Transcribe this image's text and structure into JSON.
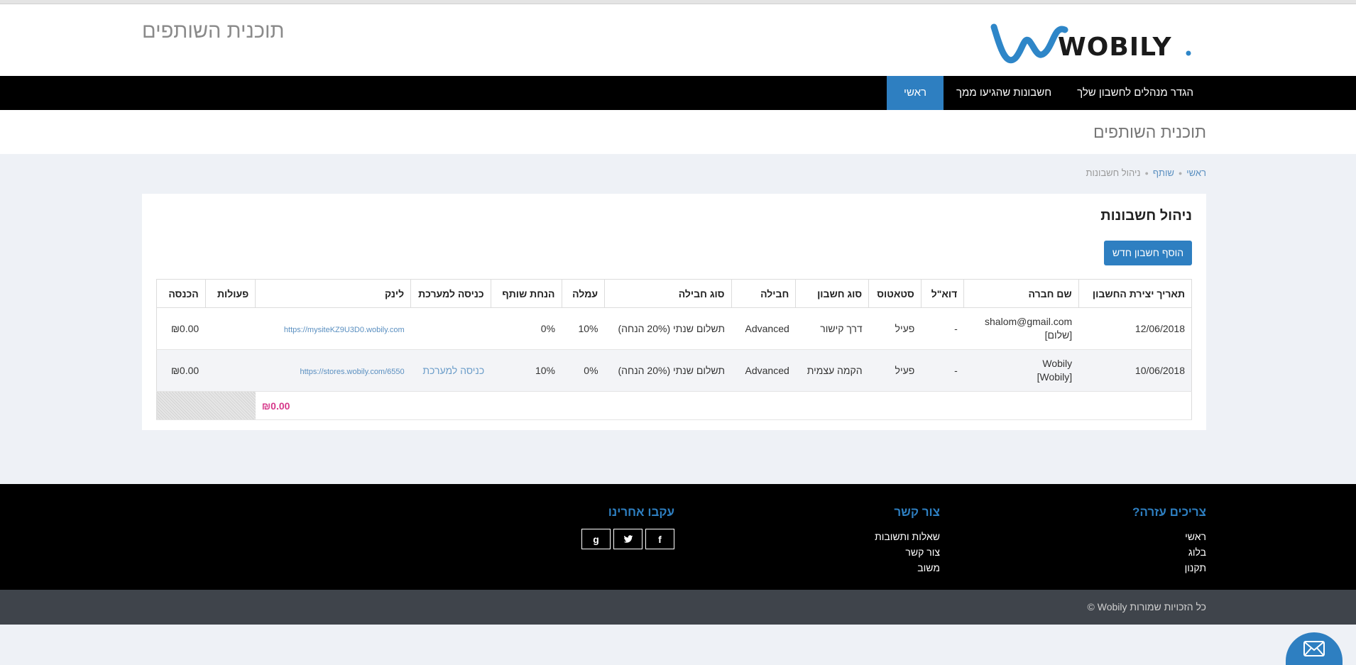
{
  "header": {
    "title": "תוכנית השותפים",
    "logo_text": "WOBILY"
  },
  "nav": {
    "items": [
      {
        "label": "ראשי",
        "active": true
      },
      {
        "label": "חשבונות שהגיעו ממך",
        "active": false
      },
      {
        "label": "הגדר מנהלים לחשבון שלך",
        "active": false
      }
    ]
  },
  "page": {
    "title": "תוכנית השותפים"
  },
  "breadcrumb": {
    "items": [
      "ראשי",
      "שותף"
    ],
    "current": "ניהול חשבונות"
  },
  "panel": {
    "title": "ניהול חשבונות",
    "add_button": "הוסף חשבון חדש"
  },
  "table": {
    "headers": {
      "created": "תאריך יצירת החשבון",
      "company": "שם חברה",
      "email": "דוא\"ל",
      "status": "סטאטוס",
      "account_type": "סוג חשבון",
      "package": "חבילה",
      "package_type": "סוג חבילה",
      "commission": "עמלה",
      "discount": "הנחת שותף",
      "login": "כניסה למערכת",
      "link": "לינק",
      "actions": "פעולות",
      "income": "הכנסה"
    },
    "rows": [
      {
        "created": "12/06/2018",
        "company_line1": "shalom@gmail.com",
        "company_line2": "[שלום]",
        "email": "-",
        "status": "פעיל",
        "account_type": "דרך קישור",
        "package": "Advanced",
        "package_type": "תשלום שנתי (20% הנחה)",
        "commission": "10%",
        "discount": "0%",
        "login": "",
        "link": "https://mysiteKZ9U3D0.wobily.com",
        "actions": "",
        "income": "₪0.00"
      },
      {
        "created": "10/06/2018",
        "company_line1": "Wobily",
        "company_line2": "[Wobily]",
        "email": "-",
        "status": "פעיל",
        "account_type": "הקמה עצמית",
        "package": "Advanced",
        "package_type": "תשלום שנתי (20% הנחה)",
        "commission": "0%",
        "discount": "10%",
        "login": "כניסה למערכת",
        "link": "https://stores.wobily.com/6550",
        "actions": "",
        "income": "₪0.00"
      }
    ],
    "total_income": "₪0.00"
  },
  "footer": {
    "help": {
      "title": "צריכים עזרה?",
      "links": [
        "ראשי",
        "בלוג",
        "תקנון"
      ]
    },
    "contact": {
      "title": "צור קשר",
      "links": [
        "שאלות ותשובות",
        "צור קשר",
        "משוב"
      ]
    },
    "follow": {
      "title": "עקבו אחרינו",
      "facebook": "f",
      "twitter": "t",
      "google": "g"
    },
    "copyright": "כל הזכויות שמורות Wobily ©"
  },
  "colors": {
    "accent": "#2e7fc1",
    "nav_bg": "#000000",
    "income_total": "#d6388a",
    "bottom_bar": "#3f444b"
  },
  "icons": {
    "chat": "envelope-icon"
  }
}
